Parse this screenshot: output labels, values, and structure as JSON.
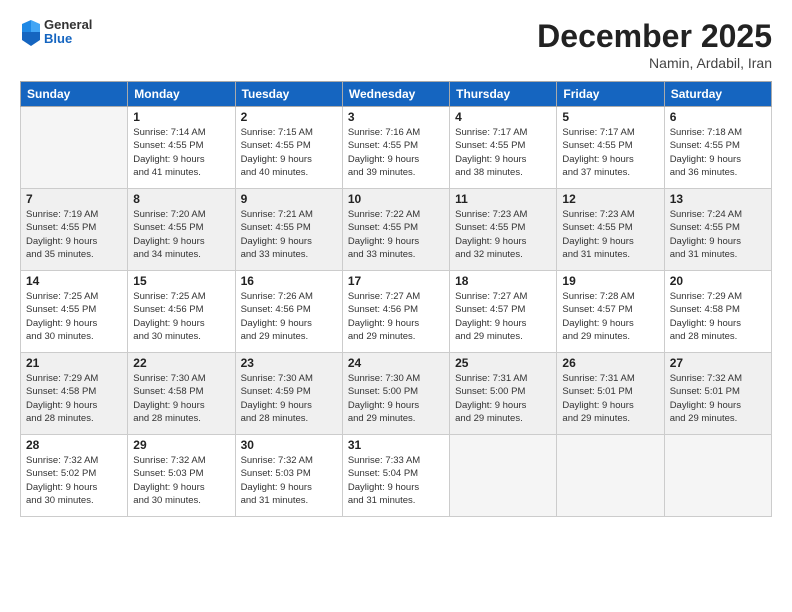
{
  "header": {
    "logo": {
      "general": "General",
      "blue": "Blue"
    },
    "title": "December 2025",
    "location": "Namin, Ardabil, Iran"
  },
  "columns": [
    "Sunday",
    "Monday",
    "Tuesday",
    "Wednesday",
    "Thursday",
    "Friday",
    "Saturday"
  ],
  "weeks": [
    {
      "shaded": false,
      "days": [
        {
          "num": "",
          "info": ""
        },
        {
          "num": "1",
          "info": "Sunrise: 7:14 AM\nSunset: 4:55 PM\nDaylight: 9 hours\nand 41 minutes."
        },
        {
          "num": "2",
          "info": "Sunrise: 7:15 AM\nSunset: 4:55 PM\nDaylight: 9 hours\nand 40 minutes."
        },
        {
          "num": "3",
          "info": "Sunrise: 7:16 AM\nSunset: 4:55 PM\nDaylight: 9 hours\nand 39 minutes."
        },
        {
          "num": "4",
          "info": "Sunrise: 7:17 AM\nSunset: 4:55 PM\nDaylight: 9 hours\nand 38 minutes."
        },
        {
          "num": "5",
          "info": "Sunrise: 7:17 AM\nSunset: 4:55 PM\nDaylight: 9 hours\nand 37 minutes."
        },
        {
          "num": "6",
          "info": "Sunrise: 7:18 AM\nSunset: 4:55 PM\nDaylight: 9 hours\nand 36 minutes."
        }
      ]
    },
    {
      "shaded": true,
      "days": [
        {
          "num": "7",
          "info": "Sunrise: 7:19 AM\nSunset: 4:55 PM\nDaylight: 9 hours\nand 35 minutes."
        },
        {
          "num": "8",
          "info": "Sunrise: 7:20 AM\nSunset: 4:55 PM\nDaylight: 9 hours\nand 34 minutes."
        },
        {
          "num": "9",
          "info": "Sunrise: 7:21 AM\nSunset: 4:55 PM\nDaylight: 9 hours\nand 33 minutes."
        },
        {
          "num": "10",
          "info": "Sunrise: 7:22 AM\nSunset: 4:55 PM\nDaylight: 9 hours\nand 33 minutes."
        },
        {
          "num": "11",
          "info": "Sunrise: 7:23 AM\nSunset: 4:55 PM\nDaylight: 9 hours\nand 32 minutes."
        },
        {
          "num": "12",
          "info": "Sunrise: 7:23 AM\nSunset: 4:55 PM\nDaylight: 9 hours\nand 31 minutes."
        },
        {
          "num": "13",
          "info": "Sunrise: 7:24 AM\nSunset: 4:55 PM\nDaylight: 9 hours\nand 31 minutes."
        }
      ]
    },
    {
      "shaded": false,
      "days": [
        {
          "num": "14",
          "info": "Sunrise: 7:25 AM\nSunset: 4:55 PM\nDaylight: 9 hours\nand 30 minutes."
        },
        {
          "num": "15",
          "info": "Sunrise: 7:25 AM\nSunset: 4:56 PM\nDaylight: 9 hours\nand 30 minutes."
        },
        {
          "num": "16",
          "info": "Sunrise: 7:26 AM\nSunset: 4:56 PM\nDaylight: 9 hours\nand 29 minutes."
        },
        {
          "num": "17",
          "info": "Sunrise: 7:27 AM\nSunset: 4:56 PM\nDaylight: 9 hours\nand 29 minutes."
        },
        {
          "num": "18",
          "info": "Sunrise: 7:27 AM\nSunset: 4:57 PM\nDaylight: 9 hours\nand 29 minutes."
        },
        {
          "num": "19",
          "info": "Sunrise: 7:28 AM\nSunset: 4:57 PM\nDaylight: 9 hours\nand 29 minutes."
        },
        {
          "num": "20",
          "info": "Sunrise: 7:29 AM\nSunset: 4:58 PM\nDaylight: 9 hours\nand 28 minutes."
        }
      ]
    },
    {
      "shaded": true,
      "days": [
        {
          "num": "21",
          "info": "Sunrise: 7:29 AM\nSunset: 4:58 PM\nDaylight: 9 hours\nand 28 minutes."
        },
        {
          "num": "22",
          "info": "Sunrise: 7:30 AM\nSunset: 4:58 PM\nDaylight: 9 hours\nand 28 minutes."
        },
        {
          "num": "23",
          "info": "Sunrise: 7:30 AM\nSunset: 4:59 PM\nDaylight: 9 hours\nand 28 minutes."
        },
        {
          "num": "24",
          "info": "Sunrise: 7:30 AM\nSunset: 5:00 PM\nDaylight: 9 hours\nand 29 minutes."
        },
        {
          "num": "25",
          "info": "Sunrise: 7:31 AM\nSunset: 5:00 PM\nDaylight: 9 hours\nand 29 minutes."
        },
        {
          "num": "26",
          "info": "Sunrise: 7:31 AM\nSunset: 5:01 PM\nDaylight: 9 hours\nand 29 minutes."
        },
        {
          "num": "27",
          "info": "Sunrise: 7:32 AM\nSunset: 5:01 PM\nDaylight: 9 hours\nand 29 minutes."
        }
      ]
    },
    {
      "shaded": false,
      "days": [
        {
          "num": "28",
          "info": "Sunrise: 7:32 AM\nSunset: 5:02 PM\nDaylight: 9 hours\nand 30 minutes."
        },
        {
          "num": "29",
          "info": "Sunrise: 7:32 AM\nSunset: 5:03 PM\nDaylight: 9 hours\nand 30 minutes."
        },
        {
          "num": "30",
          "info": "Sunrise: 7:32 AM\nSunset: 5:03 PM\nDaylight: 9 hours\nand 31 minutes."
        },
        {
          "num": "31",
          "info": "Sunrise: 7:33 AM\nSunset: 5:04 PM\nDaylight: 9 hours\nand 31 minutes."
        },
        {
          "num": "",
          "info": ""
        },
        {
          "num": "",
          "info": ""
        },
        {
          "num": "",
          "info": ""
        }
      ]
    }
  ]
}
